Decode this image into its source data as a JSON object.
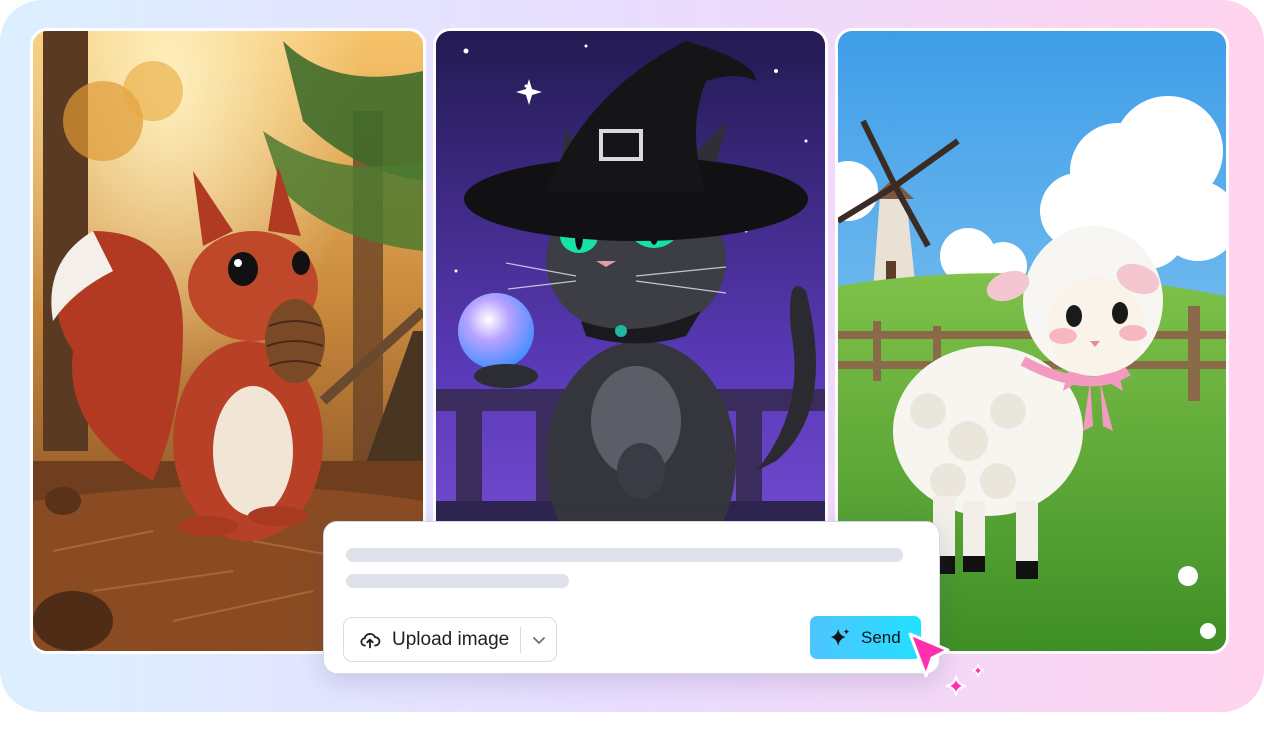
{
  "prompt_box": {
    "upload_label": "Upload image",
    "send_label": "Send"
  },
  "icons": {
    "upload": "cloud-upload-icon",
    "dropdown": "chevron-down-icon",
    "send": "sparkle-icon",
    "cursor": "mouse-pointer-icon"
  },
  "images": [
    {
      "subject": "squirrel-with-pinecone"
    },
    {
      "subject": "witch-cat-with-crystal-ball"
    },
    {
      "subject": "sheep-with-windmill"
    }
  ],
  "colors": {
    "send_button": "#3ad2ff",
    "cursor": "#ff2fae",
    "frame_left": "#dcefff",
    "frame_right": "#ffd3ee"
  }
}
